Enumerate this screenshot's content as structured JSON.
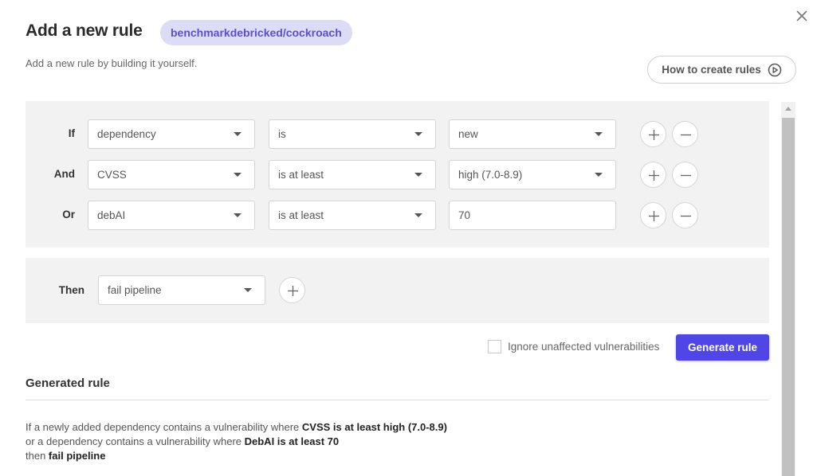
{
  "header": {
    "title": "Add a new rule",
    "repo_badge": "benchmarkdebricked/cockroach",
    "subtitle": "Add a new rule by building it yourself.",
    "howto_label": "How to create rules"
  },
  "conditions": [
    {
      "connector": "If",
      "field": "dependency",
      "operator": "is",
      "value": "new",
      "value_is_dropdown": true
    },
    {
      "connector": "And",
      "field": "CVSS",
      "operator": "is at least",
      "value": "high (7.0-8.9)",
      "value_is_dropdown": true
    },
    {
      "connector": "Or",
      "field": "debAI",
      "operator": "is at least",
      "value": "70",
      "value_is_dropdown": false
    }
  ],
  "then": {
    "label": "Then",
    "action": "fail pipeline"
  },
  "options": {
    "ignore_unaffected_label": "Ignore unaffected vulnerabilities",
    "ignore_unaffected_checked": false
  },
  "generate_button": "Generate rule",
  "generated_rule": {
    "heading": "Generated rule",
    "line1_prefix": "If a newly added dependency contains a vulnerability where ",
    "line1_bold": "CVSS is at least high (7.0-8.9)",
    "line2_prefix": "or a dependency contains a vulnerability where ",
    "line2_bold": "DebAI is at least 70",
    "line3_prefix": "then ",
    "line3_bold": "fail pipeline"
  },
  "icons": {
    "close": "close-icon",
    "howto": "play-circle-icon",
    "dropdown": "caret-down-icon",
    "add": "plus-icon",
    "remove": "minus-icon"
  },
  "colors": {
    "accent": "#4f46e5",
    "badge_bg": "#dcdcf7",
    "badge_text": "#5a4fd0",
    "panel_bg": "#f2f2f2"
  }
}
